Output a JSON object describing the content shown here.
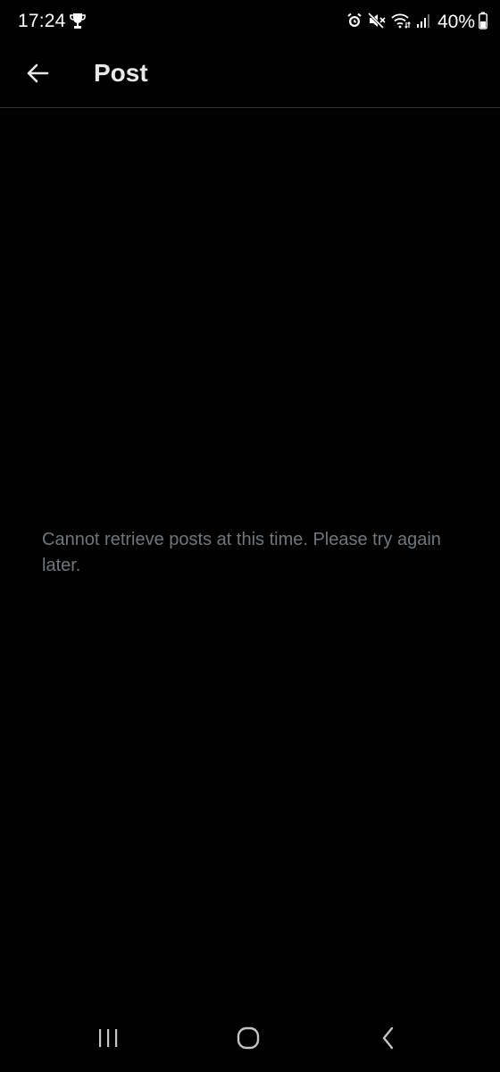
{
  "status_bar": {
    "time": "17:24",
    "battery_percent": "40%",
    "icons": [
      "trophy-icon",
      "alarm-icon",
      "mute-icon",
      "wifi-icon",
      "signal-icon",
      "battery-icon"
    ]
  },
  "header": {
    "title": "Post",
    "back_icon": "arrow-left-icon"
  },
  "main": {
    "message": "Cannot retrieve posts at this time. Please try again later."
  },
  "nav_bar": {
    "buttons": [
      "recents-icon",
      "home-icon",
      "back-icon"
    ]
  },
  "colors": {
    "background": "#000000",
    "title": "#e7e9ea",
    "message": "#71767b",
    "divider": "#2f3336",
    "nav_icons": "#c4c4c4"
  }
}
